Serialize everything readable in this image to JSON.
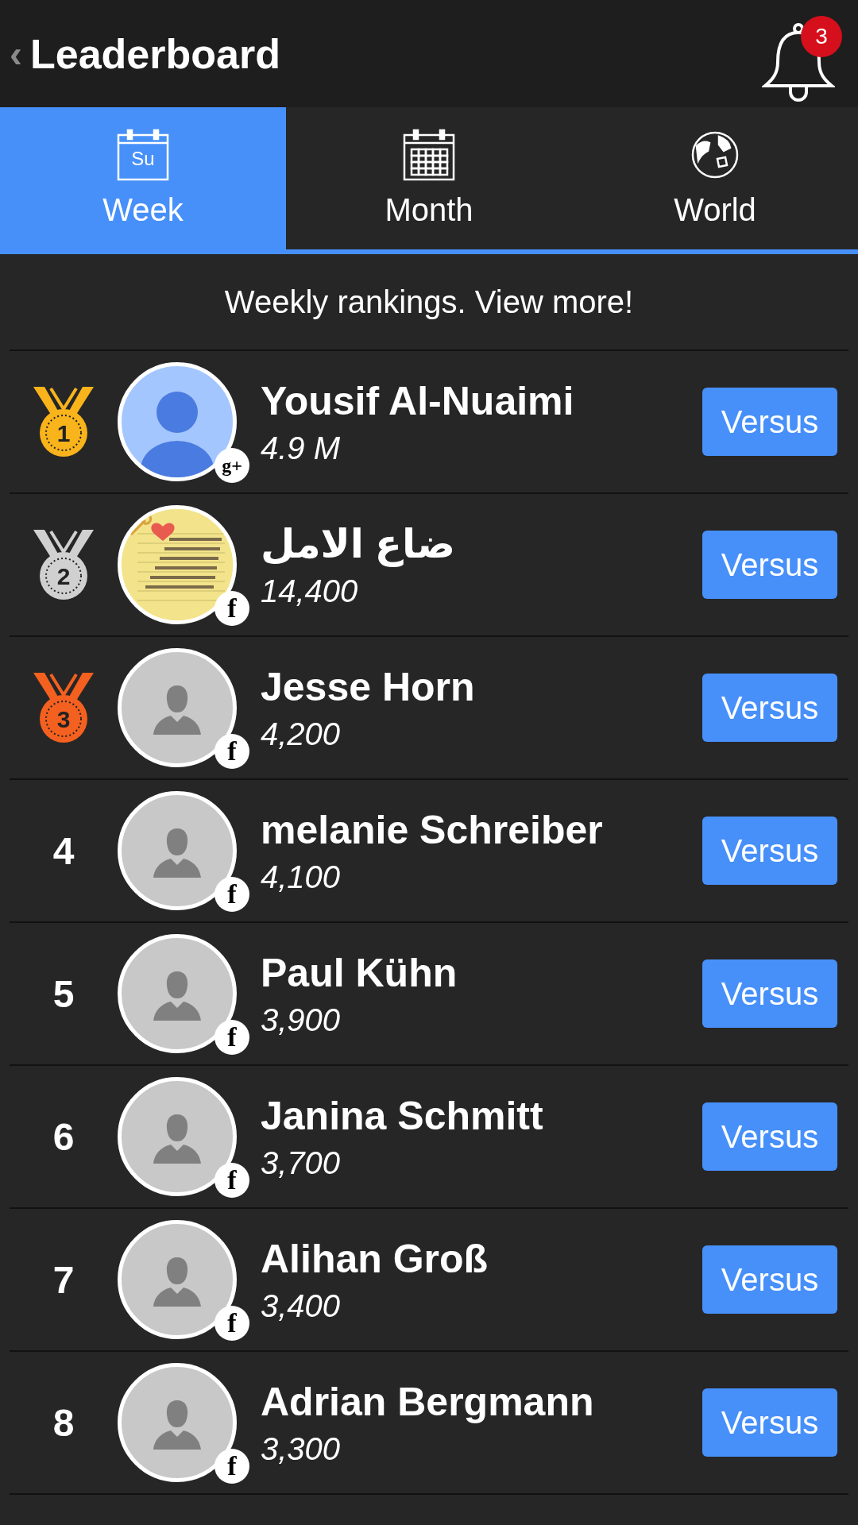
{
  "header": {
    "back": "‹",
    "title": "Leaderboard",
    "notification_count": "3"
  },
  "tabs": [
    {
      "label": "Week",
      "icon_text": "Su",
      "selected": true
    },
    {
      "label": "Month",
      "selected": false
    },
    {
      "label": "World",
      "selected": false
    }
  ],
  "subtitle": "Weekly rankings. View more!",
  "rows": [
    {
      "rank": "1",
      "kind": "medal",
      "color": "#f9b31b",
      "avatar": {
        "kind": "account"
      },
      "badge": "g+",
      "name": "Yousif Al-Nuaimi",
      "score": "4.9 M",
      "button": "Versus"
    },
    {
      "rank": "2",
      "kind": "medal",
      "color": "#d0d0d0",
      "badge": "f",
      "name": "ضاع الامل",
      "score": "14,400",
      "button": "Versus"
    },
    {
      "rank": "3",
      "kind": "medal",
      "color": "#f4601f",
      "avatar": {
        "kind": "silhouette"
      },
      "badge": "f",
      "name": "Jesse Horn",
      "score": "4,200",
      "button": "Versus"
    },
    {
      "rank": "4",
      "kind": "number",
      "avatar": {
        "kind": "silhouette"
      },
      "badge": "f",
      "name": "melanie Schreiber",
      "score": "4,100",
      "button": "Versus"
    },
    {
      "rank": "5",
      "kind": "number",
      "avatar": {
        "kind": "silhouette"
      },
      "badge": "f",
      "name": "Paul Kühn",
      "score": "3,900",
      "button": "Versus"
    },
    {
      "rank": "6",
      "kind": "number",
      "avatar": {
        "kind": "silhouette"
      },
      "badge": "f",
      "name": "Janina Schmitt",
      "score": "3,700",
      "button": "Versus"
    },
    {
      "rank": "7",
      "kind": "number",
      "avatar": {
        "kind": "silhouette"
      },
      "badge": "f",
      "name": "Alihan Groß",
      "score": "3,400",
      "button": "Versus"
    },
    {
      "rank": "8",
      "kind": "number",
      "avatar": {
        "kind": "silhouette"
      },
      "badge": "f",
      "name": "Adrian Bergmann",
      "score": "3,300",
      "button": "Versus"
    }
  ]
}
